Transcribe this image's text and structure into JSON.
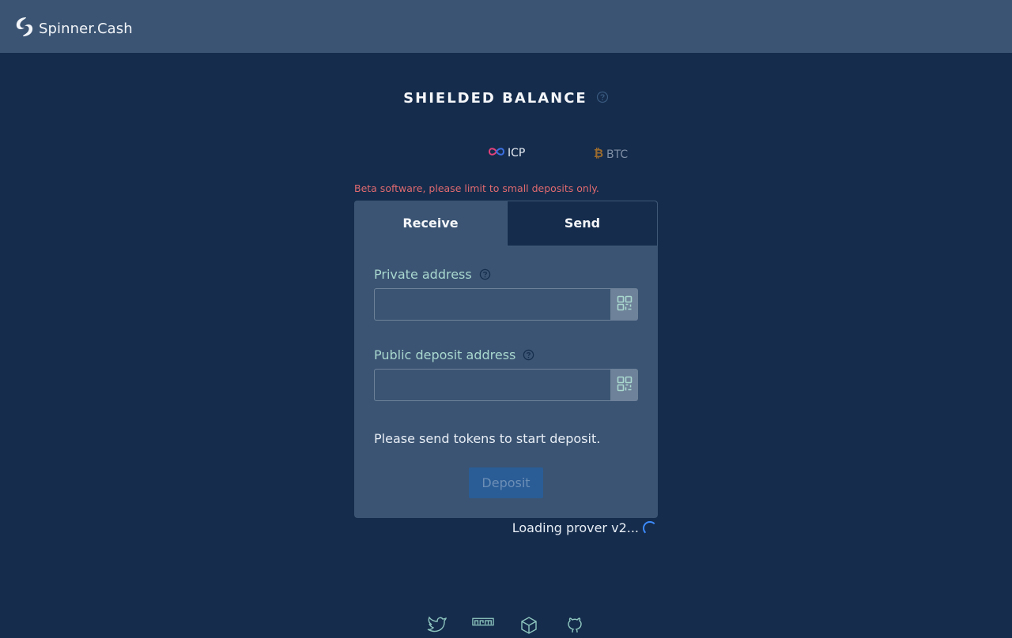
{
  "header": {
    "brand_name": "Spinner.Cash",
    "logo_icon": "spinner-logo-icon",
    "background": "#3b5473"
  },
  "balance": {
    "title": "SHIELDED BALANCE",
    "help_icon": "question-circle-icon"
  },
  "tokens": [
    {
      "label": "ICP",
      "icon": "icp-infinity-icon",
      "selected": true
    },
    {
      "label": "BTC",
      "icon": "bitcoin-icon",
      "selected": false
    }
  ],
  "warning": "Beta software, please limit to small deposits only.",
  "tabs": [
    {
      "label": "Receive",
      "active": true
    },
    {
      "label": "Send",
      "active": false
    }
  ],
  "form": {
    "private_address_label": "Private address",
    "private_address_value": "",
    "public_address_label": "Public deposit address",
    "public_address_value": "",
    "qr_icon": "qr-code-icon",
    "status_message": "Please send tokens to start deposit.",
    "deposit_button": "Deposit",
    "deposit_disabled": true
  },
  "loading_text": "Loading prover v2...",
  "footer_links": [
    {
      "icon": "twitter-icon"
    },
    {
      "icon": "npm-icon"
    },
    {
      "icon": "package-box-icon"
    },
    {
      "icon": "github-icon"
    }
  ],
  "colors": {
    "page_bg": "#152c4c",
    "card_bg": "#3b5473",
    "label_teal": "#a9d8cf",
    "warning_red": "#e06a6f",
    "button_blue": "#2a5c96",
    "spinner_blue": "#3d8bfd"
  }
}
